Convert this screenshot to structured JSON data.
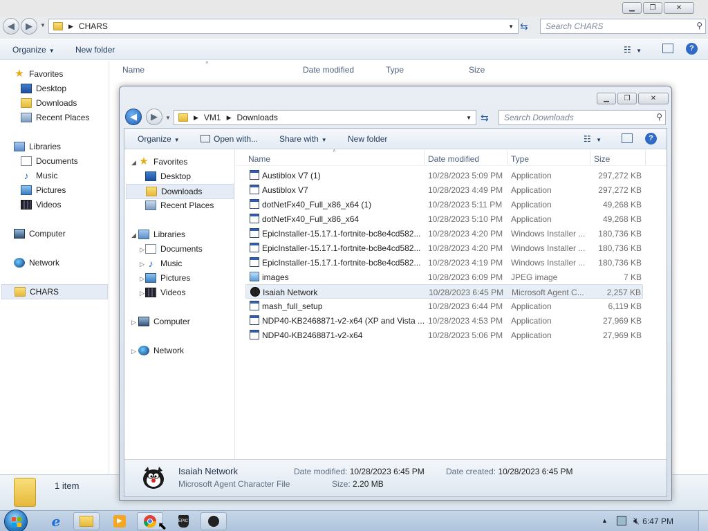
{
  "back_window": {
    "path": [
      "CHARS"
    ],
    "search_placeholder": "Search CHARS",
    "toolbar": {
      "organize": "Organize",
      "new_folder": "New folder"
    },
    "nav": {
      "favorites": "Favorites",
      "fav_items": [
        "Desktop",
        "Downloads",
        "Recent Places"
      ],
      "libraries": "Libraries",
      "lib_items": [
        "Documents",
        "Music",
        "Pictures",
        "Videos"
      ],
      "computer": "Computer",
      "network": "Network",
      "selected": "CHARS"
    },
    "columns": {
      "name": "Name",
      "date": "Date modified",
      "type": "Type",
      "size": "Size"
    },
    "status": "1 item"
  },
  "front_window": {
    "path": [
      "VM1",
      "Downloads"
    ],
    "search_placeholder": "Search Downloads",
    "toolbar": {
      "organize": "Organize",
      "open_with": "Open with...",
      "share_with": "Share with",
      "new_folder": "New folder"
    },
    "nav": {
      "favorites": "Favorites",
      "fav_items": [
        "Desktop",
        "Downloads",
        "Recent Places"
      ],
      "libraries": "Libraries",
      "lib_items": [
        "Documents",
        "Music",
        "Pictures",
        "Videos"
      ],
      "computer": "Computer",
      "network": "Network",
      "selected": "Downloads"
    },
    "columns": {
      "name": "Name",
      "date": "Date modified",
      "type": "Type",
      "size": "Size"
    },
    "files": [
      {
        "name": "Austiblox V7 (1)",
        "date": "10/28/2023 5:09 PM",
        "type": "Application",
        "size": "297,272 KB",
        "icon": "app-icon"
      },
      {
        "name": "Austiblox V7",
        "date": "10/28/2023 4:49 PM",
        "type": "Application",
        "size": "297,272 KB",
        "icon": "app-icon"
      },
      {
        "name": "dotNetFx40_Full_x86_x64 (1)",
        "date": "10/28/2023 5:11 PM",
        "type": "Application",
        "size": "49,268 KB",
        "icon": "app-icon"
      },
      {
        "name": "dotNetFx40_Full_x86_x64",
        "date": "10/28/2023 5:10 PM",
        "type": "Application",
        "size": "49,268 KB",
        "icon": "app-icon"
      },
      {
        "name": "EpicInstaller-15.17.1-fortnite-bc8e4cd582...",
        "date": "10/28/2023 4:20 PM",
        "type": "Windows Installer ...",
        "size": "180,736 KB",
        "icon": "installer-icon"
      },
      {
        "name": "EpicInstaller-15.17.1-fortnite-bc8e4cd582...",
        "date": "10/28/2023 4:20 PM",
        "type": "Windows Installer ...",
        "size": "180,736 KB",
        "icon": "installer-icon"
      },
      {
        "name": "EpicInstaller-15.17.1-fortnite-bc8e4cd582...",
        "date": "10/28/2023 4:19 PM",
        "type": "Windows Installer ...",
        "size": "180,736 KB",
        "icon": "installer-icon"
      },
      {
        "name": "images",
        "date": "10/28/2023 6:09 PM",
        "type": "JPEG image",
        "size": "7 KB",
        "icon": "image-icon"
      },
      {
        "name": "Isaiah Network",
        "date": "10/28/2023 6:45 PM",
        "type": "Microsoft Agent C...",
        "size": "2,257 KB",
        "icon": "agent-icon",
        "selected": true
      },
      {
        "name": "mash_full_setup",
        "date": "10/28/2023 6:44 PM",
        "type": "Application",
        "size": "6,119 KB",
        "icon": "app-icon"
      },
      {
        "name": "NDP40-KB2468871-v2-x64 (XP and Vista ...",
        "date": "10/28/2023 4:53 PM",
        "type": "Application",
        "size": "27,969 KB",
        "icon": "app-icon"
      },
      {
        "name": "NDP40-KB2468871-v2-x64",
        "date": "10/28/2023 5:06 PM",
        "type": "Application",
        "size": "27,969 KB",
        "icon": "app-icon"
      }
    ],
    "details": {
      "name": "Isaiah Network",
      "type": "Microsoft Agent Character File",
      "date_modified_label": "Date modified:",
      "date_modified": "10/28/2023 6:45 PM",
      "size_label": "Size:",
      "size": "2.20 MB",
      "date_created_label": "Date created:",
      "date_created": "10/28/2023 6:45 PM"
    }
  },
  "taskbar": {
    "clock": "6:47 PM",
    "apps": [
      "internet-explorer-icon",
      "windows-explorer-icon",
      "media-player-icon",
      "chrome-icon",
      "epic-games-icon",
      "agent-character-icon"
    ]
  }
}
